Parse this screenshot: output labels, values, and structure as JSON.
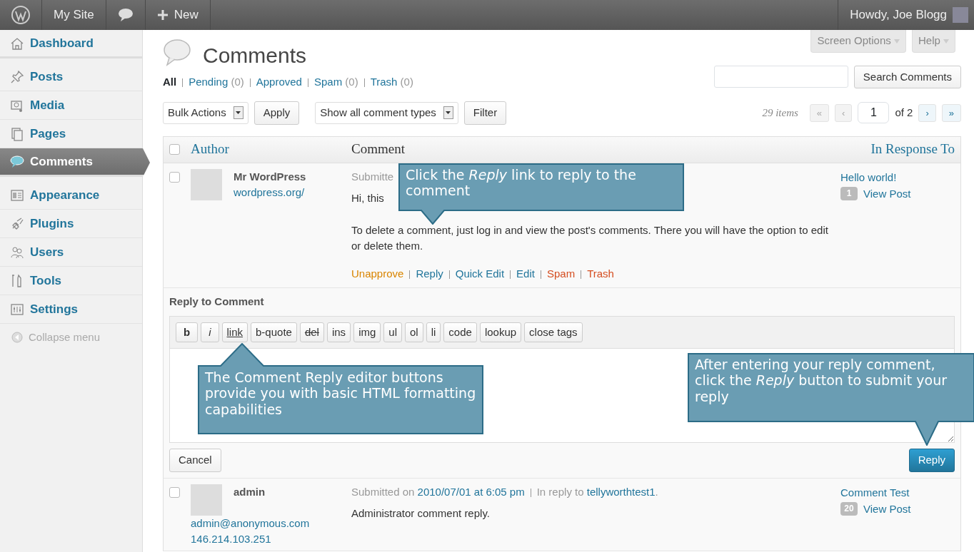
{
  "admin_bar": {
    "items": [
      {
        "kind": "logo"
      },
      {
        "kind": "text",
        "label": "My Site"
      },
      {
        "kind": "comments"
      },
      {
        "kind": "new",
        "label": "New"
      }
    ],
    "greeting": "Howdy, Joe Blogg"
  },
  "sidebar": {
    "items": [
      {
        "label": "Dashboard",
        "selected": false,
        "gap_after": true
      },
      {
        "label": "Posts",
        "selected": false
      },
      {
        "label": "Media",
        "selected": false
      },
      {
        "label": "Pages",
        "selected": false
      },
      {
        "label": "Comments",
        "selected": true,
        "gap_after": true
      },
      {
        "label": "Appearance",
        "selected": false
      },
      {
        "label": "Plugins",
        "selected": false
      },
      {
        "label": "Users",
        "selected": false
      },
      {
        "label": "Tools",
        "selected": false
      },
      {
        "label": "Settings",
        "selected": false
      }
    ],
    "collapse": "Collapse menu"
  },
  "screen_tabs": [
    "Screen Options",
    "Help"
  ],
  "title": "Comments",
  "filters": [
    {
      "label": "All",
      "selected": true
    },
    {
      "label": "Pending",
      "count": "(0)",
      "selected": false
    },
    {
      "label": "Approved",
      "selected": false
    },
    {
      "label": "Spam",
      "count": "(0)",
      "selected": false
    },
    {
      "label": "Trash",
      "count": "(0)",
      "selected": false
    }
  ],
  "search": {
    "button": "Search Comments"
  },
  "bulk": {
    "select": "Bulk Actions",
    "apply": "Apply",
    "type_select": "Show all comment types",
    "filter": "Filter"
  },
  "pagination": {
    "count": "29 items",
    "first": "«",
    "prev": "‹",
    "page": "1",
    "of": "of 2",
    "next": "›",
    "last": "»"
  },
  "table": {
    "all_checked": false,
    "columns": [
      "Author",
      "Comment",
      "In Response To"
    ],
    "rows": [
      {
        "checked": false,
        "author": "Mr WordPress",
        "author_links": [
          "wordpress.org/"
        ],
        "meta": [
          {
            "text": "Submitte",
            "link": false
          }
        ],
        "text": [
          "Hi, this",
          "To delete a comment, just log in and view the post's comments. There you will have the option to edit or delete them."
        ],
        "actions": [
          {
            "label": "Unapprove",
            "color": "#d98500"
          },
          {
            "label": "Reply",
            "color": "#21759b"
          },
          {
            "label": "Quick Edit",
            "color": "#21759b"
          },
          {
            "label": "Edit",
            "color": "#21759b"
          },
          {
            "label": "Spam",
            "color": "#d54e21"
          },
          {
            "label": "Trash",
            "color": "#d54e21"
          }
        ],
        "response": "Hello world!",
        "response_count": "1",
        "view": "View Post",
        "reply_form": true
      },
      {
        "checked": false,
        "author": "admin",
        "author_links": [
          "admin@anonymous.com",
          "146.214.103.251"
        ],
        "meta": [
          {
            "text": "Submitted on",
            "link": false
          },
          {
            "text": "2010/07/01 at 6:05 pm",
            "link": true
          },
          {
            "text": "In reply to",
            "link": false,
            "sep": true
          },
          {
            "text": "tellyworthtest1",
            "link": true
          },
          {
            "text": ".",
            "link": false
          }
        ],
        "text": [
          "Administrator comment reply."
        ],
        "actions": [],
        "response": "Comment Test",
        "response_count": "20",
        "view": "View Post"
      }
    ]
  },
  "reply_form": {
    "title": "Reply to Comment",
    "buttons": [
      {
        "label": "b",
        "kind": "bold"
      },
      {
        "label": "i",
        "kind": "italic"
      },
      {
        "label": "link",
        "kind": "link"
      },
      {
        "label": "b-quote",
        "kind": "plain"
      },
      {
        "label": "del",
        "kind": "del"
      },
      {
        "label": "ins",
        "kind": "plain"
      },
      {
        "label": "img",
        "kind": "plain"
      },
      {
        "label": "ul",
        "kind": "plain"
      },
      {
        "label": "ol",
        "kind": "plain"
      },
      {
        "label": "li",
        "kind": "plain"
      },
      {
        "label": "code",
        "kind": "plain"
      },
      {
        "label": "lookup",
        "kind": "plain"
      },
      {
        "label": "close tags",
        "kind": "plain"
      }
    ],
    "cancel": "Cancel",
    "submit": "Reply"
  },
  "callouts": [
    "Click the *Reply* link to reply to the comment",
    "The Comment Reply editor buttons provide you with basic HTML formatting capabilities",
    "After entering your reply comment, click the *Reply* button to submit your reply"
  ]
}
